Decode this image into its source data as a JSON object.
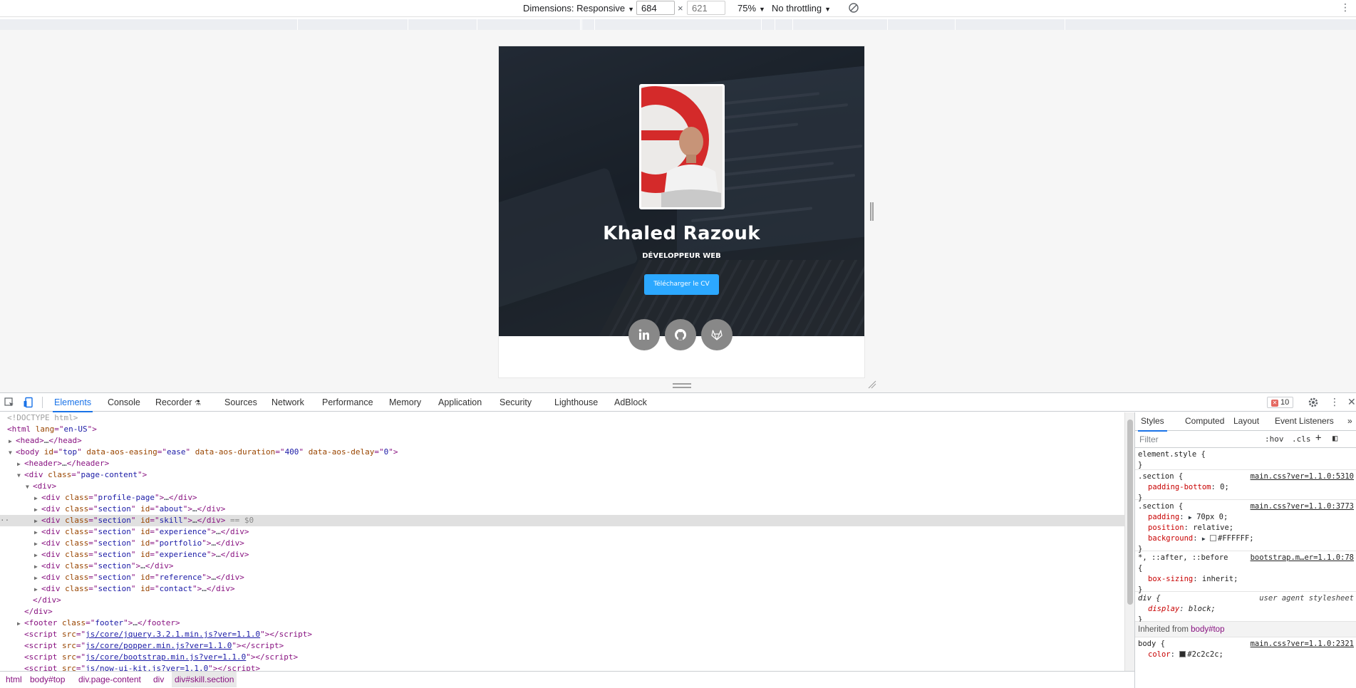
{
  "device_toolbar": {
    "dimensions_label": "Dimensions: Responsive",
    "width_value": "684",
    "height_placeholder": "621",
    "times": "×",
    "zoom": "75%",
    "throttling": "No throttling"
  },
  "page": {
    "name": "Khaled Razouk",
    "role": "DÉVELOPPEUR WEB",
    "cv_button": "Télécharger le CV",
    "accent": "#2ca8ff",
    "social": [
      "linkedin-icon",
      "github-icon",
      "gitlab-icon"
    ]
  },
  "devtools": {
    "tabs": [
      "Elements",
      "Console",
      "Recorder",
      "Sources",
      "Network",
      "Performance",
      "Memory",
      "Application",
      "Security",
      "Lighthouse",
      "AdBlock"
    ],
    "error_count": "10",
    "dom": {
      "doctype": "<!DOCTYPE html>",
      "html_lang": "en-US",
      "body_id": "top",
      "body_easing": "ease",
      "body_duration": "400",
      "body_delay": "0",
      "page_content_class": "page-content",
      "profile_class": "profile-page",
      "section_class": "section",
      "section_ids": [
        "about",
        "skill",
        "experience",
        "portfolio",
        "experience",
        "reference",
        "contact"
      ],
      "selected_marker": "== $0",
      "footer_class": "footer",
      "scripts": [
        "js/core/jquery.3.2.1.min.js?ver=1.1.0",
        "js/core/popper.min.js?ver=1.1.0",
        "js/core/bootstrap.min.js?ver=1.1.0",
        "js/now-ui-kit.js?ver=1.1.0"
      ]
    },
    "breadcrumbs": [
      "html",
      "body#top",
      "div.page-content",
      "div",
      "div#skill.section"
    ],
    "styles": {
      "tabs": [
        "Styles",
        "Computed",
        "Layout",
        "Event Listeners"
      ],
      "filter_placeholder": "Filter",
      "hov": ":hov",
      "cls": ".cls",
      "rules": [
        {
          "selector": "element.style {",
          "source": "",
          "props": []
        },
        {
          "selector": ".section {",
          "source": "main.css?ver=1.1.0:5310",
          "props": [
            [
              "padding-bottom",
              "0;"
            ]
          ]
        },
        {
          "selector": ".section {",
          "source": "main.css?ver=1.1.0:3773",
          "props": [
            [
              "padding",
              "70px 0;"
            ],
            [
              "position",
              "relative;"
            ],
            [
              "background",
              "#FFFFFF;"
            ]
          ]
        },
        {
          "selector": "*, ::after, ::before",
          "source": "bootstrap.m…er=1.1.0:78",
          "props": [
            [
              "box-sizing",
              "inherit;"
            ]
          ]
        },
        {
          "selector": "div {",
          "source": "user agent stylesheet",
          "props": [
            [
              "display",
              "block;"
            ]
          ]
        }
      ],
      "inherited_label": "Inherited from",
      "inherited_from": "body#top",
      "body_rule": {
        "selector": "body {",
        "source": "main.css?ver=1.1.0:2321",
        "prop": "color",
        "value": "#2c2c2c;"
      }
    }
  }
}
